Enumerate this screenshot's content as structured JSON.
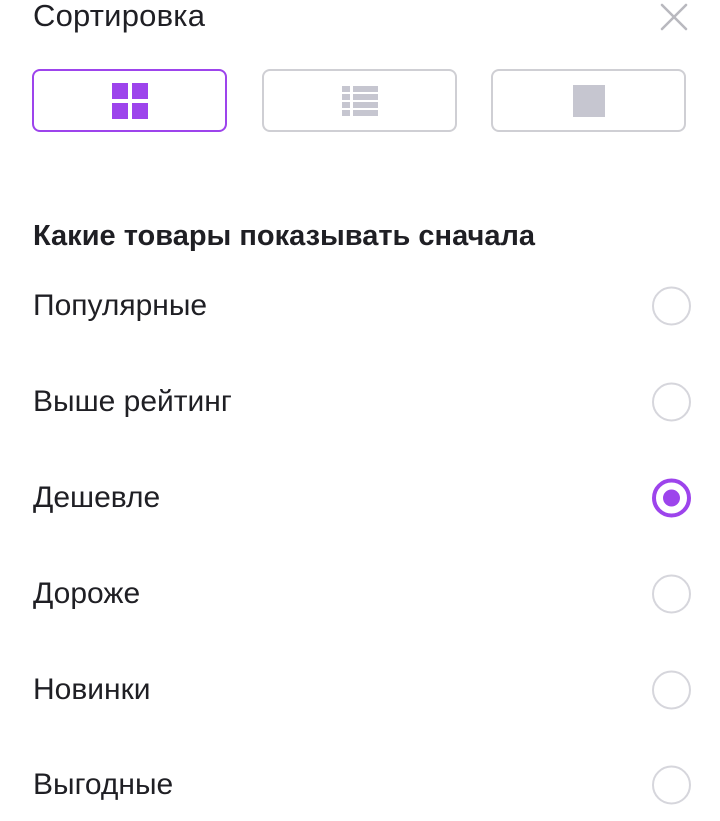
{
  "sheet": {
    "title": "Сортировка",
    "close_icon": "close-icon"
  },
  "view_modes": {
    "selected": "grid",
    "accent_color": "#9d44ec",
    "inactive_color": "#cfcfd4",
    "items": [
      {
        "id": "grid",
        "icon": "grid-view-icon"
      },
      {
        "id": "list",
        "icon": "list-view-icon"
      },
      {
        "id": "single",
        "icon": "single-view-icon"
      }
    ]
  },
  "sort": {
    "heading": "Какие товары показывать сначала",
    "selected": "Дешевле",
    "options": [
      {
        "label": "Популярные",
        "checked": false
      },
      {
        "label": "Выше рейтинг",
        "checked": false
      },
      {
        "label": "Дешевле",
        "checked": true
      },
      {
        "label": "Дороже",
        "checked": false
      },
      {
        "label": "Новинки",
        "checked": false
      },
      {
        "label": "Выгодные",
        "checked": false
      }
    ]
  }
}
